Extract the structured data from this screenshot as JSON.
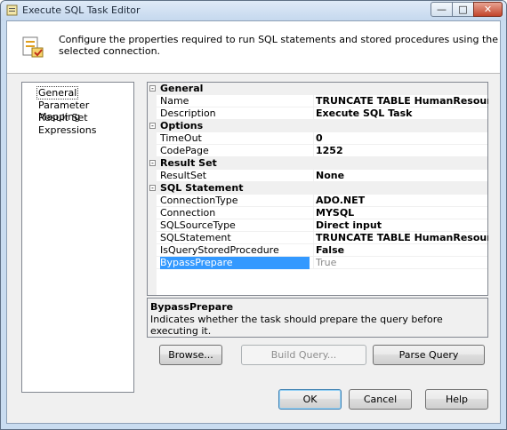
{
  "window": {
    "title": "Execute SQL Task Editor"
  },
  "header": {
    "description": "Configure the properties required to run SQL statements and stored procedures using the selected connection."
  },
  "nav": {
    "items": [
      "General",
      "Parameter Mapping",
      "Result Set",
      "Expressions"
    ],
    "selected": "General"
  },
  "grid": {
    "categories": {
      "general": "General",
      "options": "Options",
      "result_set": "Result Set",
      "sql_statement": "SQL Statement"
    },
    "props": {
      "name": {
        "label": "Name",
        "value": "TRUNCATE TABLE HumanResourcesEmployee"
      },
      "description": {
        "label": "Description",
        "value": "Execute SQL Task"
      },
      "timeout": {
        "label": "TimeOut",
        "value": "0"
      },
      "codepage": {
        "label": "CodePage",
        "value": "1252"
      },
      "resultset": {
        "label": "ResultSet",
        "value": "None"
      },
      "connectiontype": {
        "label": "ConnectionType",
        "value": "ADO.NET"
      },
      "connection": {
        "label": "Connection",
        "value": "MYSQL"
      },
      "sqlsourcetype": {
        "label": "SQLSourceType",
        "value": "Direct input"
      },
      "sqlstatement": {
        "label": "SQLStatement",
        "value": "TRUNCATE TABLE HumanResourcesEmployee;"
      },
      "isquerystoredprocedure": {
        "label": "IsQueryStoredProcedure",
        "value": "False"
      },
      "bypassprepare": {
        "label": "BypassPrepare",
        "value": "True"
      }
    }
  },
  "description_panel": {
    "title": "BypassPrepare",
    "text": "Indicates whether the task should prepare the query before executing it."
  },
  "buttons": {
    "browse": "Browse...",
    "build_query": "Build Query...",
    "parse_query": "Parse Query",
    "ok": "OK",
    "cancel": "Cancel",
    "help": "Help"
  },
  "colors": {
    "selection": "#3399ff",
    "titlebar": "#c5d8ee",
    "close": "#c2442a"
  },
  "icons": {
    "title": "task-icon",
    "header": "sql-task-icon",
    "minimize": "minimize-icon",
    "maximize": "maximize-icon",
    "close": "close-icon",
    "collapse": "collapse-icon"
  }
}
